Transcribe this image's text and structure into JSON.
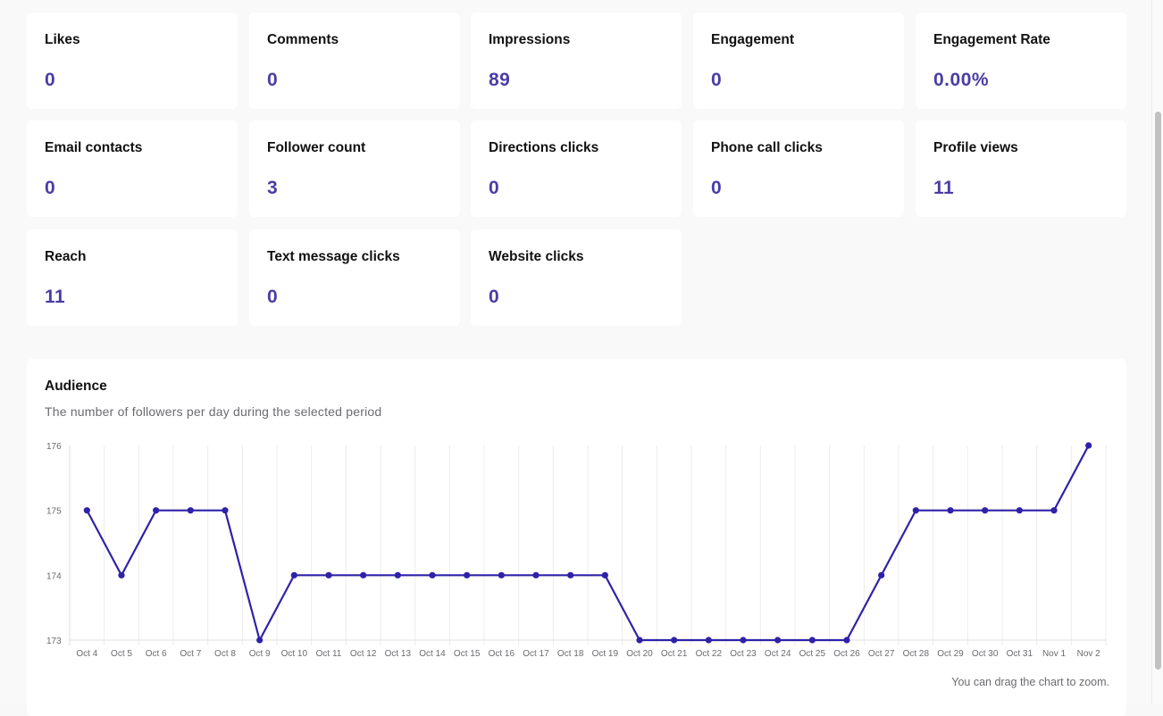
{
  "stats": [
    {
      "label": "Likes",
      "value": "0"
    },
    {
      "label": "Comments",
      "value": "0"
    },
    {
      "label": "Impressions",
      "value": "89"
    },
    {
      "label": "Engagement",
      "value": "0"
    },
    {
      "label": "Engagement Rate",
      "value": "0.00%"
    },
    {
      "label": "Email contacts",
      "value": "0"
    },
    {
      "label": "Follower count",
      "value": "3"
    },
    {
      "label": "Directions clicks",
      "value": "0"
    },
    {
      "label": "Phone call clicks",
      "value": "0"
    },
    {
      "label": "Profile views",
      "value": "11"
    },
    {
      "label": "Reach",
      "value": "11"
    },
    {
      "label": "Text message clicks",
      "value": "0"
    },
    {
      "label": "Website clicks",
      "value": "0"
    }
  ],
  "audience": {
    "title": "Audience",
    "subtitle": "The number of followers per day during the selected period",
    "hint": "You can drag the chart to zoom."
  },
  "colors": {
    "accent": "#4a3da6",
    "line": "#2e22a8",
    "grid": "#ececec"
  },
  "chart_data": {
    "type": "line",
    "title": "Audience",
    "subtitle": "The number of followers per day during the selected period",
    "xlabel": "",
    "ylabel": "",
    "categories": [
      "Oct 4",
      "Oct 5",
      "Oct 6",
      "Oct 7",
      "Oct 8",
      "Oct 9",
      "Oct 10",
      "Oct 11",
      "Oct 12",
      "Oct 13",
      "Oct 14",
      "Oct 15",
      "Oct 16",
      "Oct 17",
      "Oct 18",
      "Oct 19",
      "Oct 20",
      "Oct 21",
      "Oct 22",
      "Oct 23",
      "Oct 24",
      "Oct 25",
      "Oct 26",
      "Oct 27",
      "Oct 28",
      "Oct 29",
      "Oct 30",
      "Oct 31",
      "Nov 1",
      "Nov 2"
    ],
    "series": [
      {
        "name": "Followers",
        "values": [
          175,
          174,
          175,
          175,
          175,
          173,
          174,
          174,
          174,
          174,
          174,
          174,
          174,
          174,
          174,
          174,
          173,
          173,
          173,
          173,
          173,
          173,
          173,
          174,
          175,
          175,
          175,
          175,
          175,
          176
        ]
      }
    ],
    "yticks": [
      173,
      174,
      175,
      176
    ],
    "ylim": [
      173,
      176
    ],
    "grid": "vertical",
    "legend": "none"
  }
}
